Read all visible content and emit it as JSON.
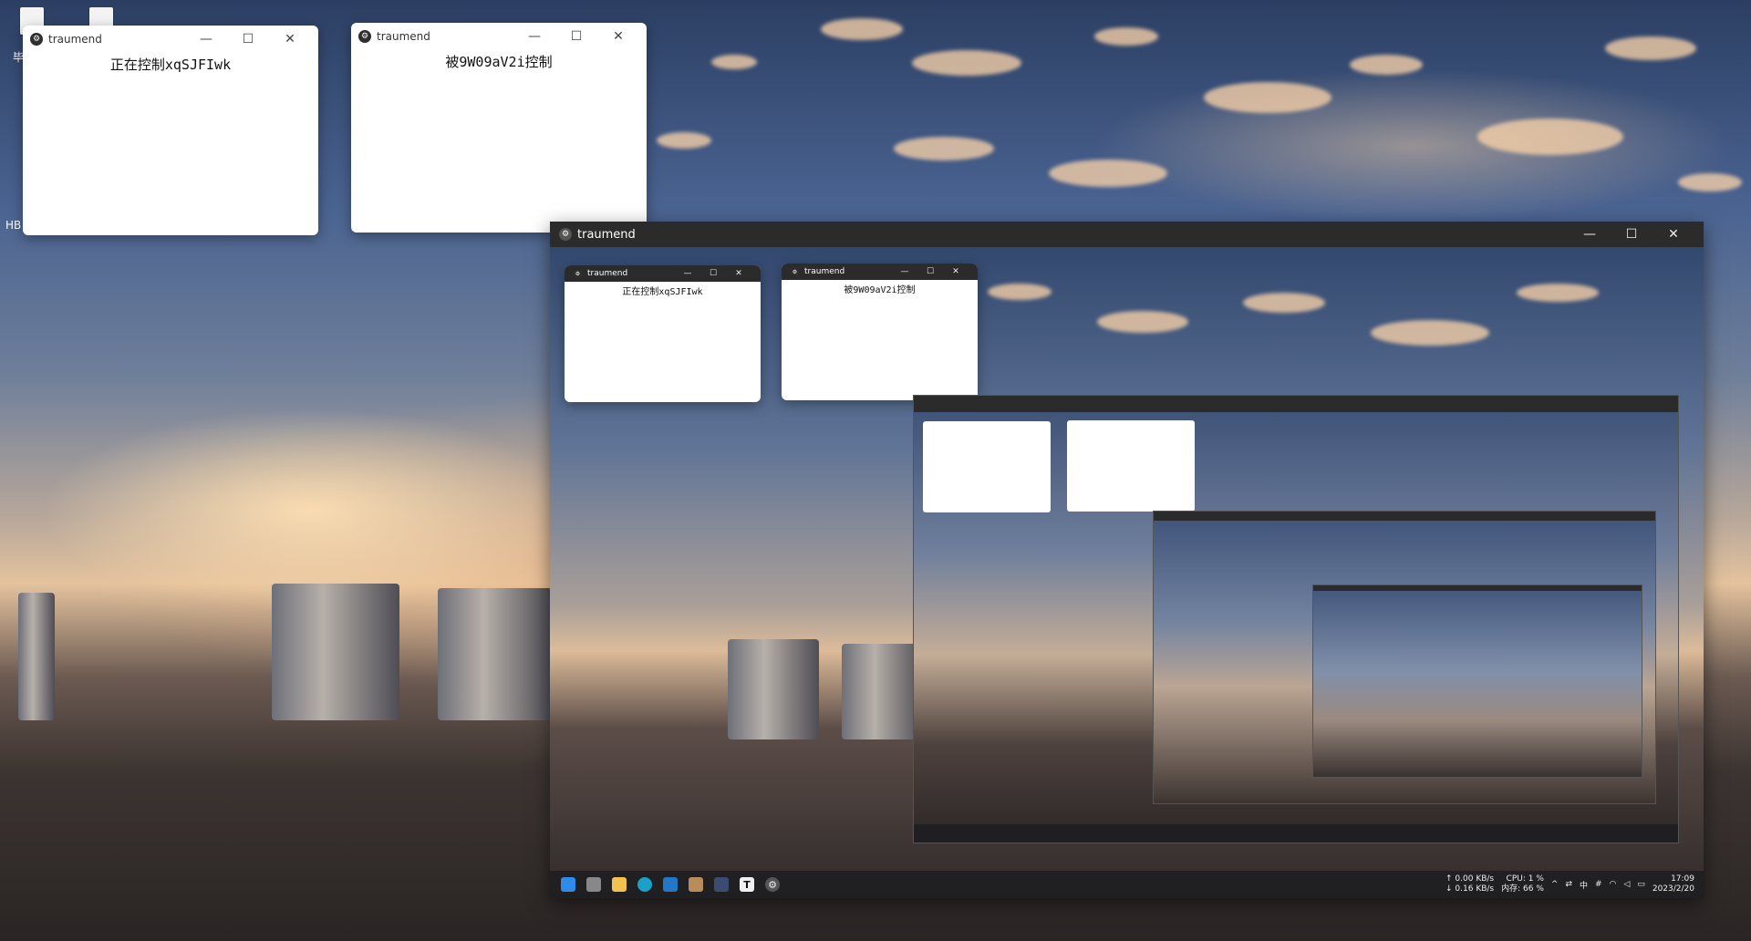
{
  "app_name": "traumend",
  "desktop": {
    "icons": [
      {
        "name": "desktop-file-icon"
      },
      {
        "name": "desktop-file-icon"
      }
    ],
    "label_fragments": [
      "毕",
      "HB"
    ]
  },
  "control_window": {
    "title": "traumend",
    "status_text": "正在控制xqSJFIwk"
  },
  "controlled_window": {
    "title": "traumend",
    "status_text": "被9W09aV2i控制"
  },
  "remote_window": {
    "title": "traumend",
    "taskbar": {
      "net_up": "↑ 0.00 KB/s",
      "net_down": "↓ 0.16 KB/s",
      "cpu": "CPU: 1 %",
      "mem": "内存: 66 %",
      "ime": "中",
      "time": "17:09",
      "date": "2023/2/20"
    }
  },
  "window_controls": {
    "minimize": "—",
    "maximize": "☐",
    "close": "✕"
  }
}
